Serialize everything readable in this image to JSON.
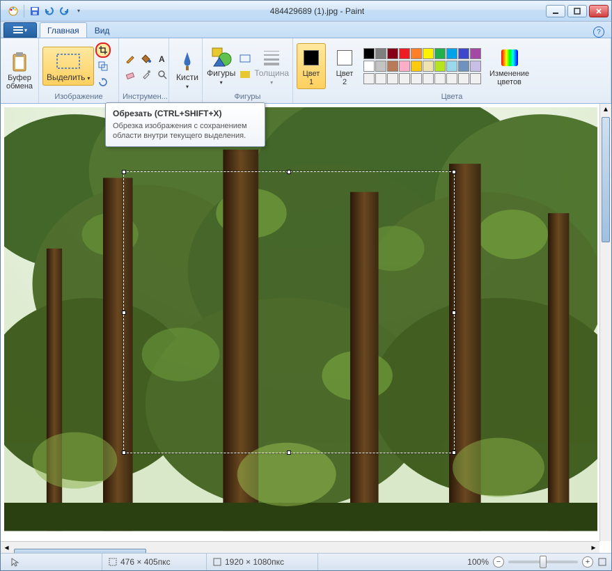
{
  "window": {
    "title": "484429689 (1).jpg - Paint"
  },
  "tabs": {
    "file_glyph": "▾",
    "home": "Главная",
    "view": "Вид"
  },
  "ribbon": {
    "clipboard": {
      "label": "Буфер\nобмена",
      "group": "Буфер обмена"
    },
    "image": {
      "select": "Выделить",
      "group": "Изображение"
    },
    "tools": {
      "group": "Инструмен..."
    },
    "brushes": {
      "label": "Кисти",
      "group": ""
    },
    "shapes": {
      "label": "Фигуры",
      "group": "Фигуры"
    },
    "thickness": {
      "label": "Толщина"
    },
    "color1": {
      "label": "Цвет\n1"
    },
    "color2": {
      "label": "Цвет\n2"
    },
    "colors_group": "Цвета",
    "edit_colors": {
      "label": "Изменение\nцветов"
    },
    "palette_row1": [
      "#000000",
      "#7f7f7f",
      "#880015",
      "#ed1c24",
      "#ff7f27",
      "#fff200",
      "#22b14c",
      "#00a2e8",
      "#3f48cc",
      "#a349a4"
    ],
    "palette_row2": [
      "#ffffff",
      "#c3c3c3",
      "#b97a57",
      "#ffaec9",
      "#ffc90e",
      "#efe4b0",
      "#b5e61d",
      "#99d9ea",
      "#7092be",
      "#c8bfe7"
    ],
    "palette_row3": [
      "#f0f0f0",
      "#f0f0f0",
      "#f0f0f0",
      "#f0f0f0",
      "#f0f0f0",
      "#f0f0f0",
      "#f0f0f0",
      "#f0f0f0",
      "#f0f0f0",
      "#f0f0f0"
    ]
  },
  "tooltip": {
    "title": "Обрезать (CTRL+SHIFT+X)",
    "body": "Обрезка изображения с сохранением области внутри текущего выделения."
  },
  "status": {
    "selection_size": "476 × 405пкс",
    "image_size": "1920 × 1080пкс",
    "zoom": "100%"
  }
}
